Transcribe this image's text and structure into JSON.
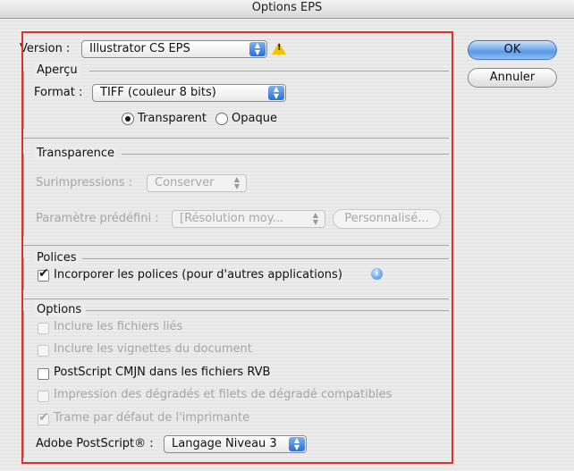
{
  "window": {
    "title": "Options EPS"
  },
  "version": {
    "label": "Version :",
    "value": "Illustrator CS EPS",
    "warning_icon": "warning-triangle-icon"
  },
  "buttons": {
    "ok": "OK",
    "cancel": "Annuler"
  },
  "apercu": {
    "section": "Aperçu",
    "format_label": "Format :",
    "format_value": "TIFF (couleur 8 bits)",
    "radio_transparent": "Transparent",
    "radio_opaque": "Opaque",
    "selected": "Transparent"
  },
  "transparence": {
    "section": "Transparence",
    "surimpressions_label": "Surimpressions :",
    "surimpressions_value": "Conserver",
    "preset_label": "Paramètre prédéfini :",
    "preset_value": "[Résolution moy...",
    "custom_button": "Personnalisé..."
  },
  "polices": {
    "section": "Polices",
    "embed_label": "Incorporer les polices (pour d'autres applications)",
    "embed_checked": true,
    "info_icon": "info-icon"
  },
  "options": {
    "section": "Options",
    "items": [
      {
        "label": "Inclure les fichiers liés",
        "checked": false,
        "enabled": false
      },
      {
        "label": "Inclure les vignettes du document",
        "checked": false,
        "enabled": false
      },
      {
        "label": "PostScript CMJN dans les fichiers RVB",
        "checked": false,
        "enabled": true
      },
      {
        "label": "Impression des dégradés et filets de dégradé compatibles",
        "checked": false,
        "enabled": false
      },
      {
        "label": "Trame par défaut de l'imprimante",
        "checked": true,
        "enabled": false
      }
    ],
    "postscript_label": "Adobe PostScript® :",
    "postscript_value": "Langage Niveau 3"
  },
  "colors": {
    "highlight_border": "#e0302c",
    "accent": "#3b7fe0"
  }
}
